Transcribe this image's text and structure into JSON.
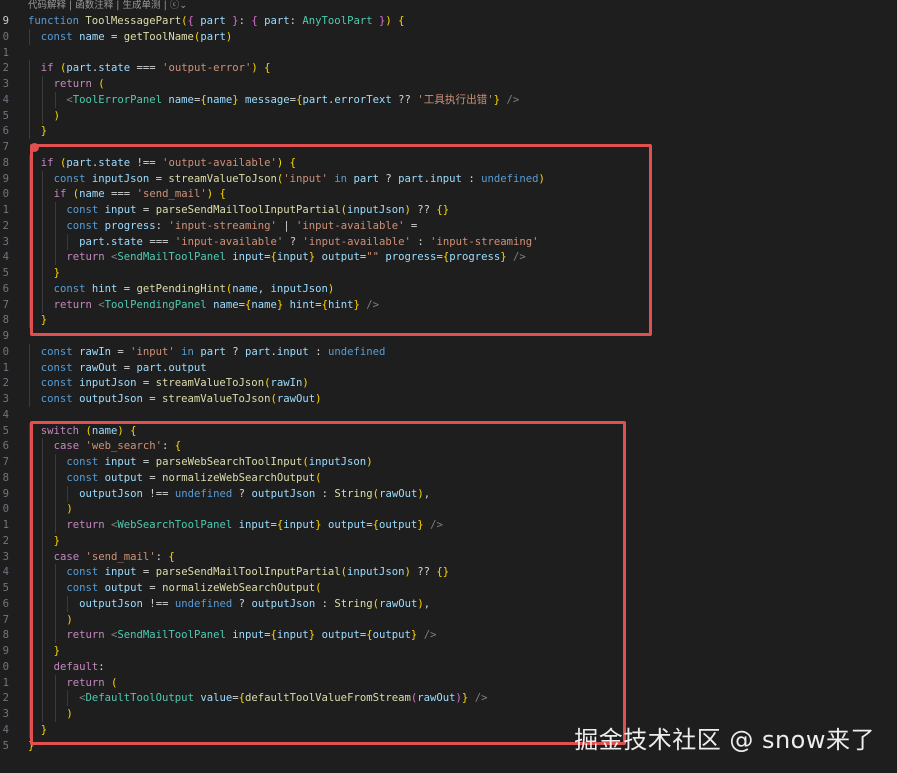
{
  "codelens": {
    "items": [
      "代码解释",
      "函数注释",
      "生成单测"
    ],
    "separator": " | ",
    "extra": "| ⓒ⌄"
  },
  "gutter": [
    "9",
    "0",
    "1",
    "2",
    "3",
    "4",
    "5",
    "6",
    "7",
    "8",
    "9",
    "0",
    "1",
    "2",
    "3",
    "4",
    "5",
    "6",
    "7",
    "8",
    "9",
    "0",
    "1",
    "2",
    "3",
    "4",
    "5",
    "6",
    "7",
    "8",
    "9",
    "0",
    "1",
    "2",
    "3",
    "4",
    "5",
    "6",
    "7",
    "8",
    "9",
    "0",
    "1",
    "2",
    "3",
    "4",
    "5"
  ],
  "code_lines": [
    "function ToolMessagePart({ part }: { part: AnyToolPart }) {",
    "  const name = getToolName(part)",
    "",
    "  if (part.state === 'output-error') {",
    "    return (",
    "      <ToolErrorPanel name={name} message={part.errorText ?? '工具执行出错'} />",
    "    )",
    "  }",
    "",
    "  if (part.state !== 'output-available') {",
    "    const inputJson = streamValueToJson('input' in part ? part.input : undefined)",
    "    if (name === 'send_mail') {",
    "      const input = parseSendMailToolInputPartial(inputJson) ?? {}",
    "      const progress: 'input-streaming' | 'input-available' =",
    "        part.state === 'input-available' ? 'input-available' : 'input-streaming'",
    "      return <SendMailToolPanel input={input} output=\"\" progress={progress} />",
    "    }",
    "    const hint = getPendingHint(name, inputJson)",
    "    return <ToolPendingPanel name={name} hint={hint} />",
    "  }",
    "",
    "  const rawIn = 'input' in part ? part.input : undefined",
    "  const rawOut = part.output",
    "  const inputJson = streamValueToJson(rawIn)",
    "  const outputJson = streamValueToJson(rawOut)",
    "",
    "  switch (name) {",
    "    case 'web_search': {",
    "      const input = parseWebSearchToolInput(inputJson)",
    "      const output = normalizeWebSearchOutput(",
    "        outputJson !== undefined ? outputJson : String(rawOut),",
    "      )",
    "      return <WebSearchToolPanel input={input} output={output} />",
    "    }",
    "    case 'send_mail': {",
    "      const input = parseSendMailToolInputPartial(inputJson) ?? {}",
    "      const output = normalizeWebSearchOutput(",
    "        outputJson !== undefined ? outputJson : String(rawOut),",
    "      )",
    "      return <SendMailToolPanel input={input} output={output} />",
    "    }",
    "    default:",
    "      return (",
    "        <DefaultToolOutput value={defaultToolValueFromStream(rawOut)} />",
    "      )",
    "  }",
    "}"
  ],
  "annotation_colors": {
    "highlight_box": "#e05050"
  },
  "watermark": "掘金技术社区 @ snow来了"
}
